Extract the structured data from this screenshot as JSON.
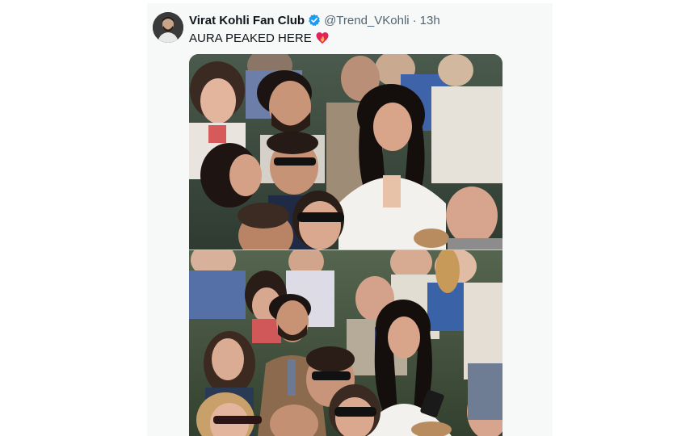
{
  "tweet": {
    "display_name": "Virat Kohli Fan Club",
    "verified_icon": "verified-badge-icon",
    "handle": "@Trend_VKohli",
    "separator": "·",
    "timestamp": "13h",
    "text": "AURA PEAKED HERE",
    "emoji_icon": "heart-on-fire-emoji",
    "avatar_icon": "profile-avatar",
    "media": [
      {
        "description_icon": "photo-top"
      },
      {
        "description_icon": "photo-bottom"
      }
    ]
  },
  "colors": {
    "name": "#0f1419",
    "secondary": "#536471",
    "verified": "#1d9bf0",
    "card_bg": "#f7f9f9"
  }
}
